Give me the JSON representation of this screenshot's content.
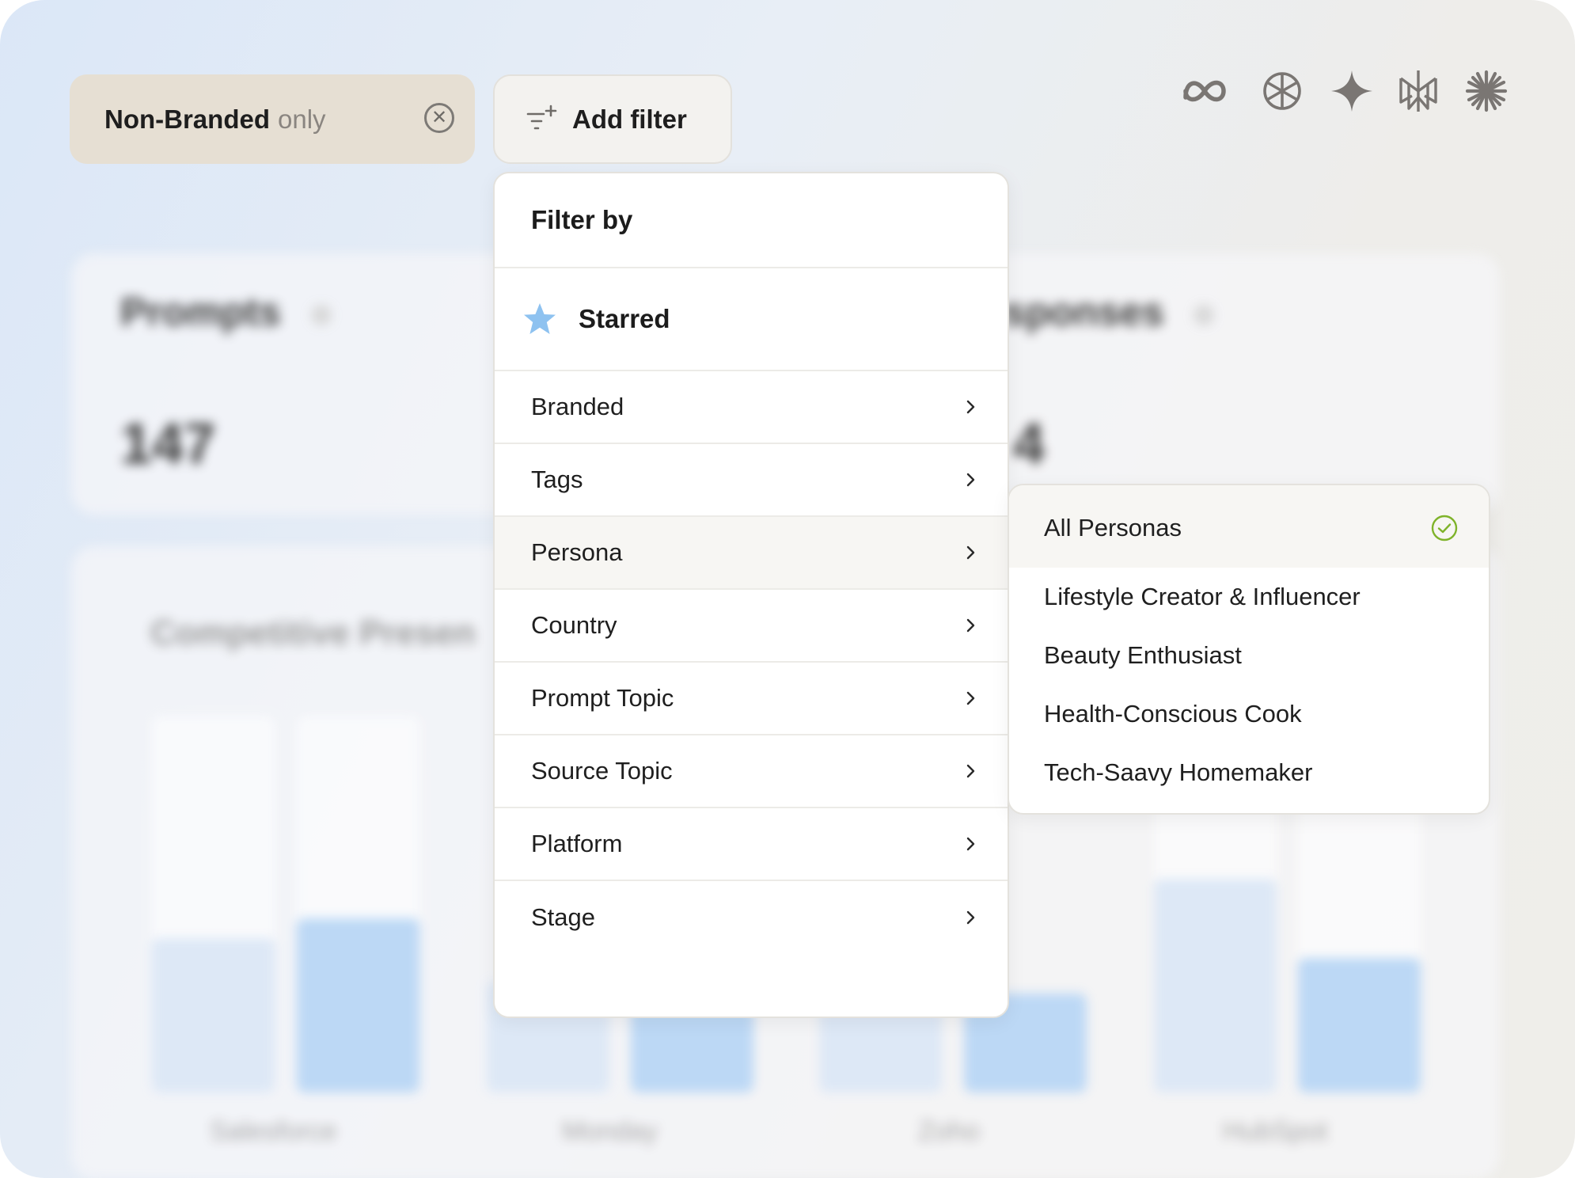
{
  "background": {
    "cards": [
      {
        "title": "Prompts",
        "value": "147"
      },
      {
        "title": "sponses",
        "value": "4"
      }
    ],
    "chart_title": "Competitive Presen",
    "x_labels": [
      "Salesforce",
      "Monday",
      "Zoho",
      "HubSpot"
    ],
    "colors": {
      "bar_light": "#dde8f6",
      "bar_strong": "#bcd8f5"
    }
  },
  "toolbar": {
    "active_filter": {
      "label": "Non-Branded",
      "suffix": "only"
    },
    "add_filter_label": "Add filter"
  },
  "model_icons": [
    "meta-icon",
    "openai-icon",
    "gemini-icon",
    "perplexity-icon",
    "claude-icon"
  ],
  "filter_menu": {
    "header": "Filter by",
    "starred_label": "Starred",
    "items": [
      {
        "label": "Branded"
      },
      {
        "label": "Tags"
      },
      {
        "label": "Persona",
        "active": true
      },
      {
        "label": "Country"
      },
      {
        "label": "Prompt Topic"
      },
      {
        "label": "Source Topic"
      },
      {
        "label": "Platform"
      },
      {
        "label": "Stage"
      }
    ]
  },
  "persona_submenu": {
    "items": [
      {
        "label": "All Personas",
        "selected": true
      },
      {
        "label": "Lifestyle Creator & Influencer"
      },
      {
        "label": "Beauty Enthusiast"
      },
      {
        "label": "Health-Conscious Cook"
      },
      {
        "label": "Tech-Saavy Homemaker"
      }
    ]
  },
  "colors": {
    "chip_active_bg": "#e6dfd3",
    "star": "#8ec2f0",
    "check": "#7fb32a"
  }
}
